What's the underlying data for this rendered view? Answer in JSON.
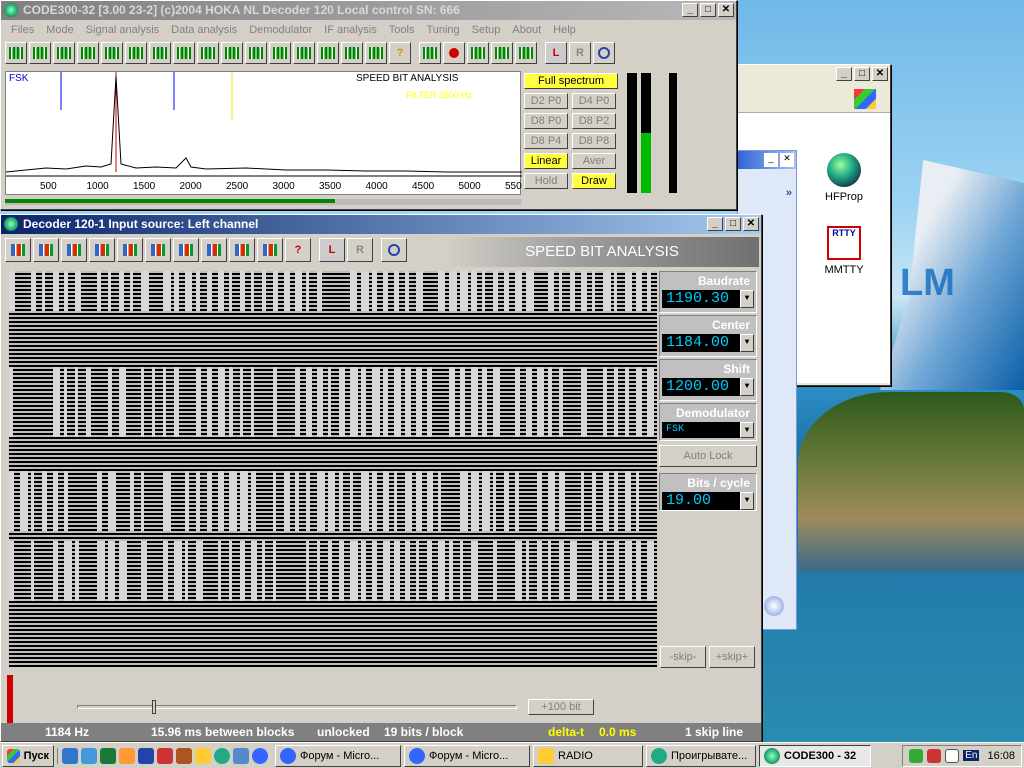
{
  "main_window": {
    "title": "CODE300-32 [3.00 23-2] (c)2004 HOKA NL   Decoder 120    Local control   SN: 666",
    "menu": [
      "Files",
      "Mode",
      "Signal analysis",
      "Data analysis",
      "Demodulator",
      "IF analysis",
      "Tools",
      "Tuning",
      "Setup",
      "About",
      "Help"
    ],
    "mode_label": "FSK",
    "analysis_title": "SPEED BIT ANALYSIS",
    "filter_label": "FILTER 3500 Hz",
    "freq_ticks": [
      "500",
      "1000",
      "1500",
      "2000",
      "2500",
      "3000",
      "3500",
      "4000",
      "4500",
      "5000",
      "550"
    ],
    "side_buttons": [
      {
        "label": "Full spectrum",
        "active": true
      },
      {
        "label": "D2 P0",
        "active": false
      },
      {
        "label": "D4 P0",
        "active": false
      },
      {
        "label": "D8 P0",
        "active": false
      },
      {
        "label": "D8 P2",
        "active": false
      },
      {
        "label": "D8 P4",
        "active": false
      },
      {
        "label": "D8 P8",
        "active": false
      },
      {
        "label": "Linear",
        "active": true
      },
      {
        "label": "Aver",
        "active": false
      },
      {
        "label": "Hold",
        "active": false
      },
      {
        "label": "Draw",
        "active": true
      }
    ]
  },
  "decoder_window": {
    "title": "Decoder 120-1        Input source: Left channel",
    "header": "SPEED BIT ANALYSIS",
    "baudrate_label": "Baudrate",
    "baudrate_value": "1190.30",
    "center_label": "Center",
    "center_value": "1184.00",
    "shift_label": "Shift",
    "shift_value": "1200.00",
    "demodulator_label": "Demodulator",
    "demodulator_value": "FSK",
    "auto_lock": "Auto Lock",
    "bits_label": "Bits / cycle",
    "bits_value": "19.00",
    "skip_minus": "-skip-",
    "skip_plus": "+skip+",
    "plus100": "+100 bit",
    "status": {
      "freq": "1184 Hz",
      "blocks": "15.96 ms between blocks",
      "lock": "unlocked",
      "bits_block": "19 bits / block",
      "delta_label": "delta-t",
      "delta_value": "0.0 ms",
      "skip_line": "1 skip line"
    }
  },
  "desktop_icons": [
    {
      "label": "HFProp"
    },
    {
      "label": "MMTTY",
      "icon_text": "RTTY"
    }
  ],
  "taskbar": {
    "start": "Пуск",
    "tasks": [
      {
        "label": "Форум - Micro...",
        "pressed": false
      },
      {
        "label": "Форум - Micro...",
        "pressed": false
      },
      {
        "label": "RADIO",
        "pressed": false
      },
      {
        "label": "Проигрывате...",
        "pressed": false
      },
      {
        "label": "CODE300 - 32",
        "pressed": true
      }
    ],
    "lang": "En",
    "clock": "16:08"
  }
}
